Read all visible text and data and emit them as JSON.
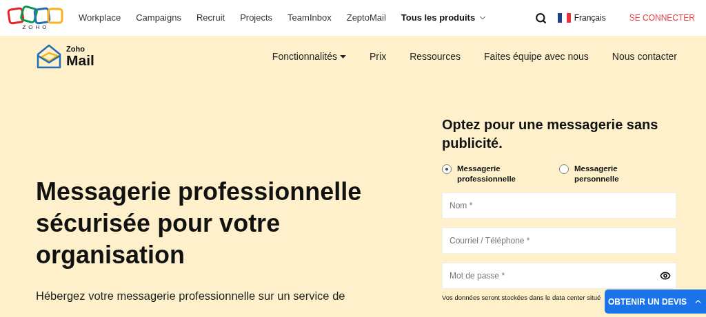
{
  "top_nav": {
    "logo_text": "ZOHO",
    "links": [
      "Workplace",
      "Campaigns",
      "Recruit",
      "Projects",
      "TeamInbox",
      "ZeptoMail"
    ],
    "all_products": "Tous les produits",
    "language": "Français",
    "sign_in": "SE CONNECTER"
  },
  "product_nav": {
    "logo_small": "Zoho",
    "logo_big": "Mail",
    "links": [
      {
        "label": "Fonctionnalités",
        "dropdown": true
      },
      {
        "label": "Prix",
        "dropdown": false
      },
      {
        "label": "Ressources",
        "dropdown": false
      },
      {
        "label": "Faites équipe avec nous",
        "dropdown": false
      },
      {
        "label": "Nous contacter",
        "dropdown": false
      }
    ]
  },
  "hero": {
    "title": "Messagerie professionnelle sécurisée pour votre organisation",
    "description_lines": [
      "Hébergez votre messagerie professionnelle sur un service de"
    ]
  },
  "signup": {
    "title": "Optez pour une messagerie sans publicité.",
    "account_types": [
      {
        "label": "Messagerie professionnelle",
        "selected": true
      },
      {
        "label": "Messagerie personnelle",
        "selected": false
      }
    ],
    "fields": [
      {
        "placeholder": "Nom *",
        "kind": "text"
      },
      {
        "placeholder": "Courriel / Téléphone *",
        "kind": "text"
      },
      {
        "placeholder": "Mot de passe *",
        "kind": "password"
      }
    ],
    "data_center_note": "Vos données seront stockées dans le data center situé"
  },
  "quote_button": "OBTENIR UN DEVIS"
}
